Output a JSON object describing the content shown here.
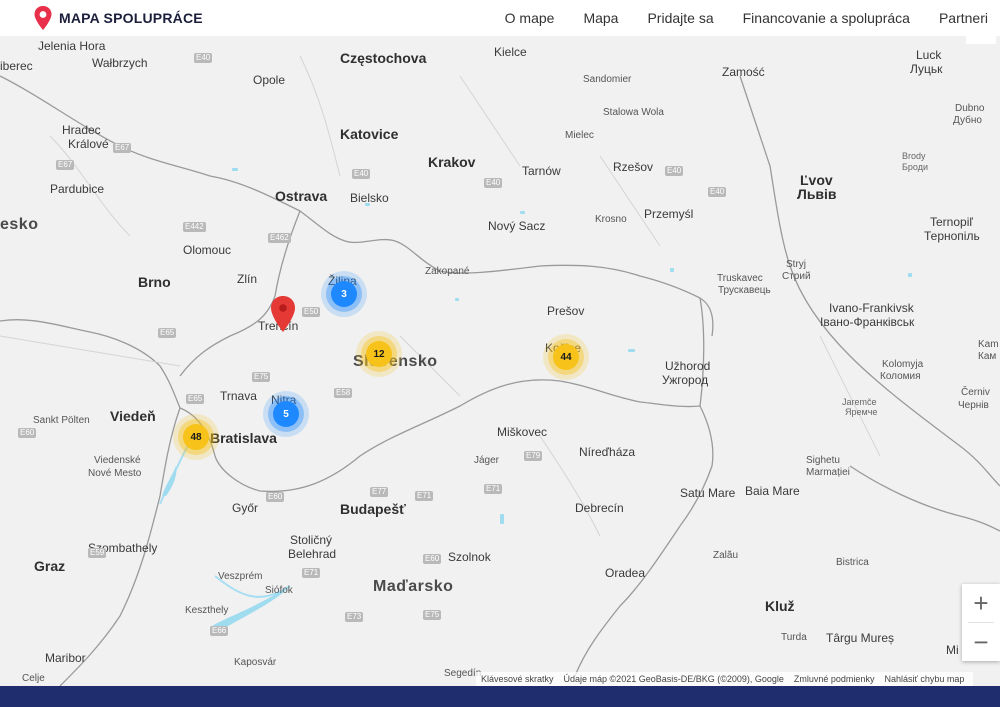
{
  "header": {
    "title": "MAPA SPOLUPRÁCE",
    "logo_icon": "location-pin-icon",
    "nav": [
      "O mape",
      "Mapa",
      "Pridajte sa",
      "Financovanie a spolupráca",
      "Partneri"
    ]
  },
  "map": {
    "labels": {
      "jelenia_hora": "Jelenia Hora",
      "liberec": "iberec",
      "walbrzych": "Wałbrzych",
      "opole": "Opole",
      "czestochowa": "Częstochova",
      "kielce": "Kielce",
      "sandomier": "Sandomier",
      "zamosc": "Zamość",
      "luck": "Luck",
      "luck_cyr": "Луцьк",
      "dubno": "Dubno",
      "dubno_cyr": "Дубно",
      "stalowa_wola": "Stalowa Wola",
      "hradec": "Hradec",
      "kralove": "Králové",
      "katovice": "Katovice",
      "mielec": "Mielec",
      "pardubice": "Pardubice",
      "krakov": "Krakov",
      "tarnow": "Tarnów",
      "rzesov": "Rzešov",
      "brody": "Brody",
      "brody_cyr": "Броди",
      "ostrava": "Ostrava",
      "bielsko": "Bielsko",
      "lvov": "Ľvov",
      "lvov_cyr": "Львів",
      "cesko": "esko",
      "krosno": "Krosno",
      "przemysl": "Przemyśl",
      "novy_sacz": "Nový Sacz",
      "ternopil": "Ternopiľ",
      "ternopil_cyr": "Тернопіль",
      "olomouc": "Olomouc",
      "zakopane": "Zakopané",
      "stryj": "Stryj",
      "stryj_cyr": "Стрий",
      "zlin": "Zlín",
      "zilina": "Žilina",
      "truskavec": "Truskavec",
      "truskavec_cyr": "Трускавець",
      "brno": "Brno",
      "presov": "Prešov",
      "ivano": "Ivano-Frankivsk",
      "ivano_cyr": "Івано-Франківськ",
      "trencin": "Trenčín",
      "kosice": "Košice",
      "slovensko": "Slovensko",
      "uzhorod": "Užhorod",
      "uzhorod_cyr": "Ужгород",
      "kolomyja": "Kolomyja",
      "kolomyja_cyr": "Коломия",
      "kam": "Kam",
      "kam_cyr": "Кам",
      "trnava": "Trnava",
      "nitra": "Nitra",
      "jaremce": "Jaremče",
      "jaremce_cyr": "Яремче",
      "cernivce": "Černiv",
      "cernivce_cyr": "Чернів",
      "sankt_polten": "Sankt Pölten",
      "vieden": "Viedeň",
      "bratislava": "Bratislava",
      "miskovec": "Miškovec",
      "niredhaza": "Níreďháza",
      "viedenske": "Viedenské",
      "nove_mesto": "Nové Mesto",
      "jager": "Jáger",
      "sighetu": "Sighetu",
      "marmatiei": "Marmației",
      "gyor": "Győr",
      "satu_mare": "Satu Mare",
      "baia_mare": "Baia Mare",
      "budapest": "Budapešť",
      "debrecin": "Debrecín",
      "szombathely": "Szombathely",
      "stolicny": "Stoličný",
      "belehrad": "Belehrad",
      "szolnok": "Szolnok",
      "graz": "Graz",
      "zalau": "Zalău",
      "bistrica": "Bistrica",
      "vesprem": "Veszprém",
      "oradea": "Oradea",
      "siofok": "Siófok",
      "madarsko": "Maďarsko",
      "keszthely": "Keszthely",
      "kluz": "Kluž",
      "turda": "Turda",
      "targu_mures": "Târgu Mureș",
      "maribor": "Maribor",
      "kaposvar": "Kaposvár",
      "celje": "Celje",
      "segedin": "Segedín",
      "mi": "Mi"
    },
    "roads": {
      "e40a": "E40",
      "e40b": "E40",
      "e40c": "E40",
      "e40d": "E40",
      "e40e": "E40",
      "e67a": "E67",
      "e67b": "E67",
      "e442a": "E442",
      "e462": "E462",
      "e50": "E50",
      "e65a": "E65",
      "e65b": "E65",
      "e75": "E75",
      "e58": "E58",
      "e60a": "E60",
      "e60b": "E60",
      "e60c": "E60",
      "e77": "E77",
      "e71a": "E71",
      "e71b": "E71",
      "e71c": "E71",
      "e79": "E79",
      "e59": "E59",
      "e73": "E73",
      "e75b": "E75",
      "e66": "E66"
    },
    "clusters": [
      {
        "name": "cluster-zilina",
        "count": "3",
        "color": "blue"
      },
      {
        "name": "cluster-central-slovakia",
        "count": "12",
        "color": "yellow"
      },
      {
        "name": "cluster-kosice",
        "count": "44",
        "color": "yellow"
      },
      {
        "name": "cluster-nitra",
        "count": "5",
        "color": "blue"
      },
      {
        "name": "cluster-bratislava",
        "count": "48",
        "color": "yellow"
      }
    ],
    "colors": {
      "blue_cluster": "#1e88ff",
      "yellow_cluster": "#f7c21a",
      "marker": "#e53935",
      "footer": "#1f2c6e",
      "water": "#9fdcf0"
    },
    "controls": {
      "zoom_in": "+",
      "zoom_out": "−"
    },
    "attribution": {
      "shortcuts": "Klávesové skratky",
      "data": "Údaje máp ©2021 GeoBasis-DE/BKG (©2009), Google",
      "terms": "Zmluvné podmienky",
      "report": "Nahlásiť chybu map"
    }
  }
}
